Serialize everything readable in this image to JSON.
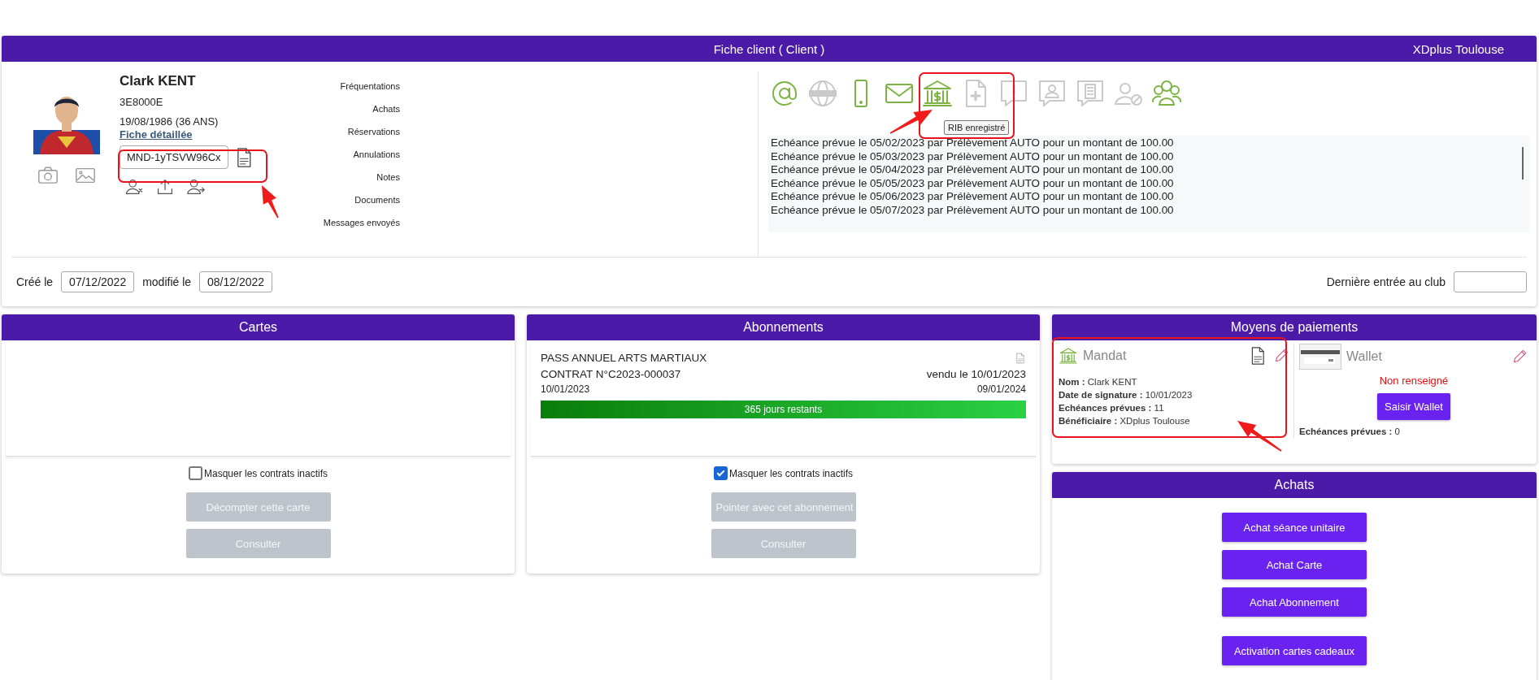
{
  "client_card": {
    "title": "Fiche client ( Client )",
    "club": "XDplus Toulouse",
    "profile": {
      "name": "Clark KENT",
      "code": "3E8000E",
      "birth": "19/08/1986 (36 ANS)",
      "detail_link": "Fiche détaillée",
      "mandate_ref": "MND-1yTSVW96Cx"
    },
    "history_links": [
      "Fréquentations",
      "Achats",
      "Réservations",
      "Annulations",
      "Notes",
      "Documents",
      "Messages envoyés"
    ],
    "contact_icons": [
      {
        "kind": "at",
        "active": true
      },
      {
        "kind": "web",
        "active": false
      },
      {
        "kind": "phone",
        "active": true
      },
      {
        "kind": "mail",
        "active": true
      },
      {
        "kind": "bank",
        "active": true
      },
      {
        "kind": "doc",
        "active": false
      },
      {
        "kind": "alert",
        "active": false
      },
      {
        "kind": "person-chat",
        "active": false
      },
      {
        "kind": "building-chat",
        "active": false
      },
      {
        "kind": "person-block",
        "active": false
      },
      {
        "kind": "group",
        "active": true
      }
    ],
    "tooltip": "RIB enregistré",
    "schedule": [
      "Echéance prévue le 05/02/2023 par Prélèvement AUTO pour un montant de 100.00",
      "Echéance prévue le 05/03/2023 par Prélèvement AUTO pour un montant de 100.00",
      "Echéance prévue le 05/04/2023 par Prélèvement AUTO pour un montant de 100.00",
      "Echéance prévue le 05/05/2023 par Prélèvement AUTO pour un montant de 100.00",
      "Echéance prévue le 05/06/2023 par Prélèvement AUTO pour un montant de 100.00",
      "Echéance prévue le 05/07/2023 par Prélèvement AUTO pour un montant de 100.00"
    ],
    "created_label": "Créé le",
    "created": "07/12/2022",
    "modified_label": "modifié le",
    "modified": "08/12/2022",
    "last_entry_label": "Dernière entrée au club"
  },
  "cartes": {
    "title": "Cartes",
    "hide_inactive": {
      "label": "Masquer les contrats inactifs",
      "checked": false
    },
    "buttons": [
      {
        "label": "Décompter cette carte",
        "disabled": true
      },
      {
        "label": "Consulter",
        "disabled": true
      }
    ]
  },
  "abonnements": {
    "title": "Abonnements",
    "contracts": [
      {
        "name": "PASS ANNUEL ARTS MARTIAUX",
        "number": "CONTRAT N°C2023-000037",
        "sold": "vendu le 10/01/2023",
        "start": "10/01/2023",
        "end": "09/01/2024",
        "remaining": "365 jours restants",
        "level": 1
      }
    ],
    "hide_inactive": {
      "label": "Masquer les contrats inactifs",
      "checked": true
    },
    "buttons": [
      {
        "label": "Pointer avec cet abonnement",
        "disabled": true
      },
      {
        "label": "Consulter",
        "disabled": true
      }
    ]
  },
  "payments": {
    "title": "Moyens de paiements",
    "mandate": {
      "title": "Mandat",
      "fields": [
        "**Nom :** Clark KENT",
        "**Date de signature :** 10/01/2023",
        "**Echéances prévues :** 11",
        "**Bénéficiaire :** XDplus Toulouse"
      ]
    },
    "wallet": {
      "title": "Wallet",
      "status": "Non renseigné",
      "button": "Saisir Wallet",
      "fields": [
        "**Echéances prévues :** 0"
      ]
    }
  },
  "achats": {
    "title": "Achats",
    "buttons": [
      "Achat séance unitaire",
      "Achat Carte",
      "Achat Abonnement",
      "Activation cartes cadeaux"
    ]
  }
}
